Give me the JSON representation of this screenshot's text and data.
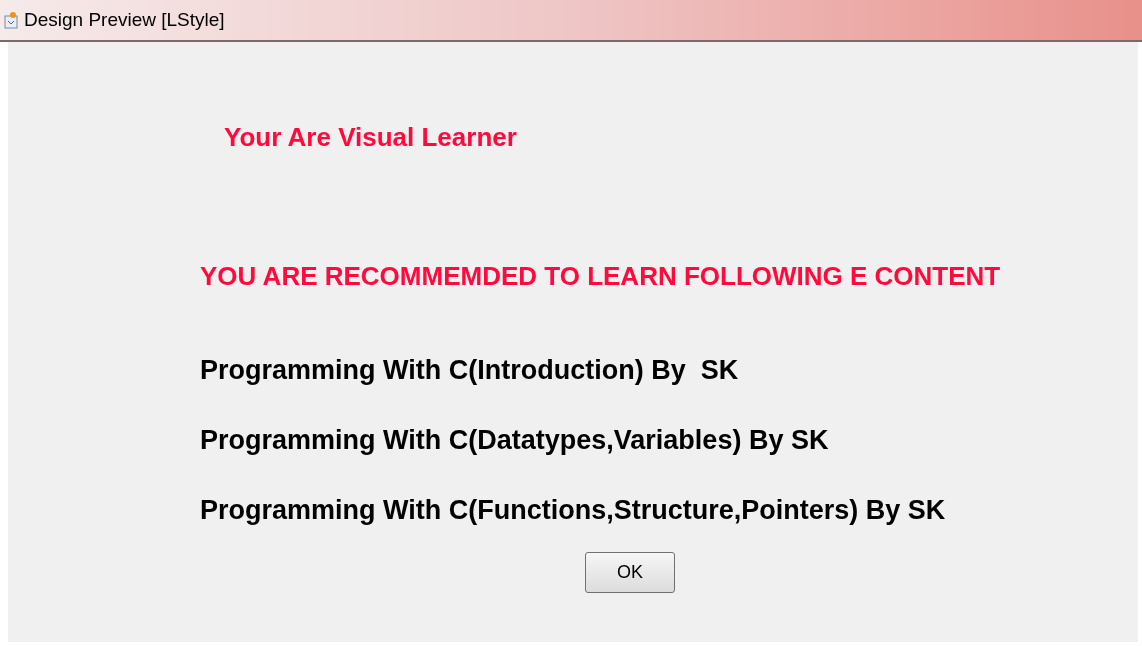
{
  "window": {
    "title": "Design Preview [LStyle]"
  },
  "result": "Your Are Visual Learner",
  "recommendation": "YOU ARE RECOMMEMDED TO LEARN FOLLOWING E CONTENT",
  "courses": [
    "Programming With C(Introduction) By  SK",
    "Programming With C(Datatypes,Variables) By SK",
    "Programming With C(Functions,Structure,Pointers) By SK"
  ],
  "buttons": [
    "OK"
  ]
}
